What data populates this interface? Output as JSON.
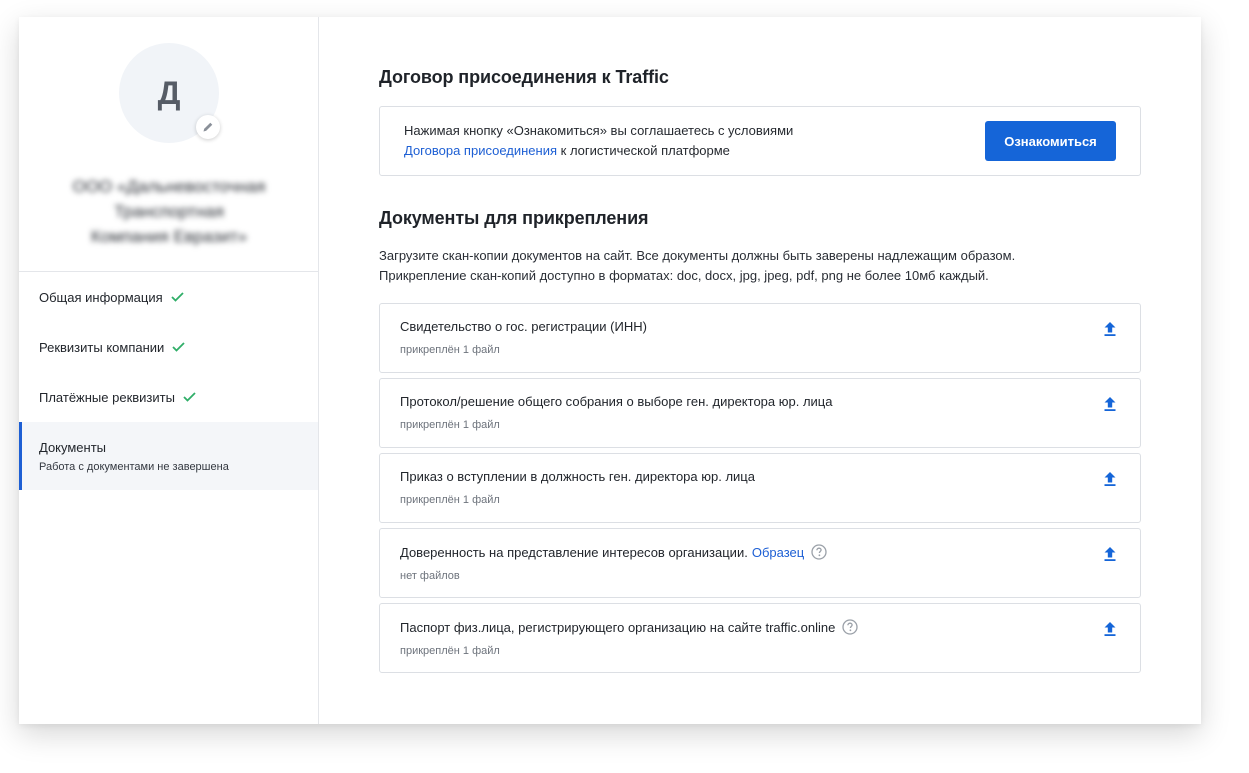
{
  "profile": {
    "avatar_letter": "Д",
    "company_name": "ООО «Дальневосточная\nТранспортная\nКомпания Евразит»"
  },
  "sidebar": {
    "items": [
      {
        "label": "Общая информация",
        "completed": true
      },
      {
        "label": "Реквизиты компании",
        "completed": true
      },
      {
        "label": "Платёжные реквизиты",
        "completed": true
      },
      {
        "label": "Документы",
        "subtitle": "Работа с документами не завершена",
        "active": true
      }
    ]
  },
  "agreement": {
    "title": "Договор присоединения к Traffic",
    "text_before": "Нажимая кнопку «Ознакомиться» вы соглашаетесь с условиями",
    "link": "Договора присоединения",
    "text_after": " к логистической платформе",
    "button_label": "Ознакомиться"
  },
  "documents": {
    "title": "Документы для прикрепления",
    "description_line1": "Загрузите скан-копии документов на сайт. Все документы должны быть заверены надлежащим образом.",
    "description_line2": "Прикрепление скан-копий доступно в форматах: doc, docx,  jpg, jpeg, pdf, png не более 10мб каждый.",
    "items": [
      {
        "title": "Свидетельство о гос. регистрации (ИНН)",
        "status": "прикреплён 1 файл"
      },
      {
        "title": "Протокол/решение общего собрания о выборе ген. директора юр. лица",
        "status": "прикреплён 1 файл"
      },
      {
        "title": "Приказ о вступлении в должность ген. директора юр. лица",
        "status": "прикреплён 1 файл"
      },
      {
        "title": "Доверенность на представление интересов организации.",
        "link": "Образец",
        "status": "нет файлов"
      },
      {
        "title": "Паспорт физ.лица, регистрирующего организацию на сайте traffic.online",
        "status": "прикреплён 1 файл"
      }
    ]
  },
  "colors": {
    "accent": "#1565d8",
    "link": "#1d5fd4",
    "check": "#2fae68",
    "border": "#dcdfe4"
  },
  "icons": {
    "avatar_edit": "pencil-icon",
    "nav_complete": "check-icon",
    "doc_upload": "upload-icon",
    "help": "question-circle-icon"
  }
}
